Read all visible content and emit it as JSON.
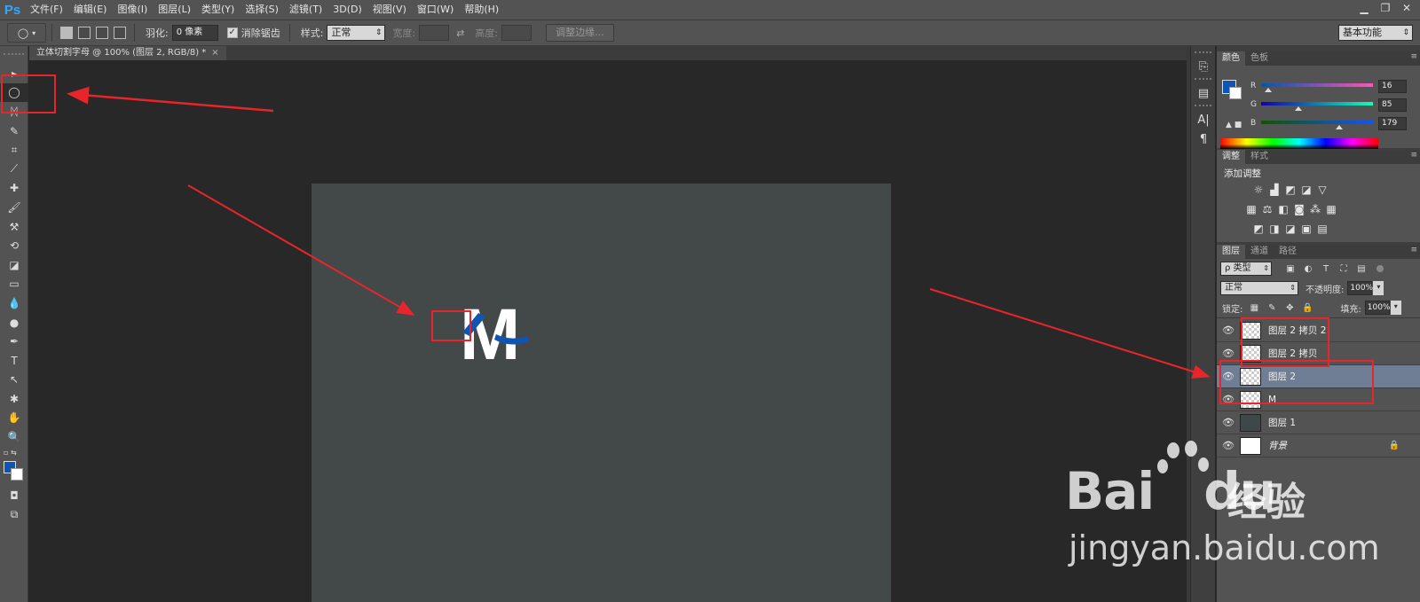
{
  "app": {
    "logo": "Ps",
    "menus": [
      "文件(F)",
      "编辑(E)",
      "图像(I)",
      "图层(L)",
      "类型(Y)",
      "选择(S)",
      "滤镜(T)",
      "3D(D)",
      "视图(V)",
      "窗口(W)",
      "帮助(H)"
    ],
    "window_controls": [
      "minimize",
      "restore",
      "close"
    ]
  },
  "options_bar": {
    "tool_preset_icon": "elliptical-marquee-icon",
    "feather_label": "羽化:",
    "feather_value": "0 像素",
    "antialias_label": "消除锯齿",
    "antialias_checked": true,
    "style_label": "样式:",
    "style_value": "正常",
    "width_label": "宽度:",
    "height_label": "高度:",
    "refine_edge_label": "调整边缘...",
    "workspace": "基本功能"
  },
  "document": {
    "tab_title": "立体切割字母 @ 100% (图层 2, RGB/8) *",
    "letter": "M",
    "background_color": "#434949",
    "accent_color": "#1055b3"
  },
  "tools": [
    "move-icon",
    "elliptical-marquee-icon",
    "lasso-icon",
    "quick-select-icon",
    "crop-icon",
    "eyedropper-icon",
    "healing-brush-icon",
    "brush-icon",
    "clone-stamp-icon",
    "history-brush-icon",
    "eraser-icon",
    "gradient-icon",
    "blur-icon",
    "dodge-icon",
    "pen-icon",
    "type-icon",
    "path-select-icon",
    "shape-icon",
    "hand-icon",
    "zoom-icon"
  ],
  "tools_glyphs": [
    "▸",
    "◯",
    "ᛞ",
    "✎",
    "⌗",
    "⟋",
    "✚",
    "🖌",
    "⚒",
    "⟲",
    "◪",
    "▭",
    "💧",
    "●",
    "✒",
    "T",
    "↖",
    "✱",
    "✋",
    "🔍"
  ],
  "colors": {
    "foreground": "#1055b3",
    "background": "#ffffff"
  },
  "color_panel": {
    "tabs": [
      "颜色",
      "色板"
    ],
    "r_label": "R",
    "g_label": "G",
    "b_label": "B",
    "r": "16",
    "g": "85",
    "b": "179",
    "r_fraction": 0.063,
    "g_fraction": 0.333,
    "b_fraction": 0.702
  },
  "adjustments_panel": {
    "tabs": [
      "调整",
      "样式"
    ],
    "title": "添加调整"
  },
  "layers_panel": {
    "tabs": [
      "图层",
      "通道",
      "路径"
    ],
    "filter_kind": "ρ 类型",
    "blend_mode": "正常",
    "opacity_label": "不透明度:",
    "opacity": "100%",
    "lock_label": "锁定:",
    "fill_label": "填充:",
    "fill": "100%",
    "layers": [
      {
        "name": "图层 2 拷贝 2",
        "selected": false
      },
      {
        "name": "图层 2 拷贝",
        "selected": false
      },
      {
        "name": "图层 2",
        "selected": true
      },
      {
        "name": "M",
        "selected": false
      },
      {
        "name": "图层 1",
        "selected": false
      },
      {
        "name": "背景",
        "selected": false,
        "locked": true
      }
    ]
  },
  "watermark": {
    "brand": "Bai",
    "brand_du": "du",
    "cn": "经验",
    "url": "jingyan.baidu.com"
  }
}
